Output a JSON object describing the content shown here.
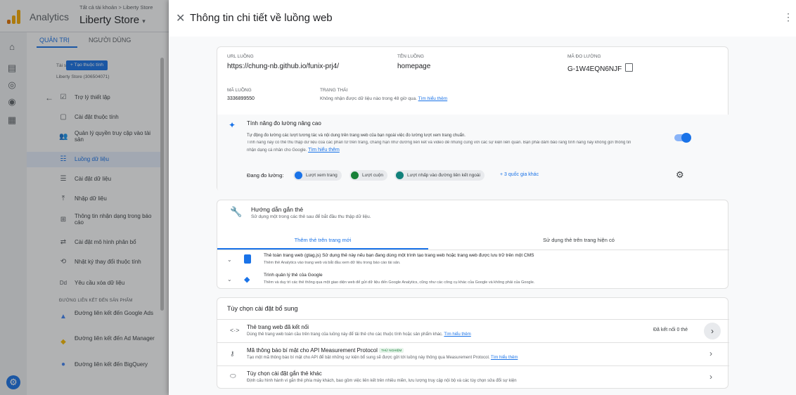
{
  "app": {
    "name": "Analytics",
    "breadcrumb": "Tất cả tài khoản > Liberty Store",
    "property": "Liberty Store",
    "colors": {
      "accent": "#1a73e8",
      "logo_orange": "#f9ab00",
      "logo_dark": "#e37400"
    }
  },
  "left_panel": {
    "tabs": [
      {
        "label": "QUẢN TRỊ",
        "active": true
      },
      {
        "label": "NGƯỜI DÙNG",
        "active": false
      }
    ],
    "asset_label": "Tài sản",
    "create_property_label": "+ Tạo thuộc tính",
    "property_id": "Liberty Store (306504071)",
    "items": [
      {
        "label": "Trợ lý thiết lập",
        "icon": "checklist-icon"
      },
      {
        "label": "Cài đặt thuộc tính",
        "icon": "property-icon"
      },
      {
        "label": "Quản lý quyền truy cập vào tài sản",
        "icon": "people-icon"
      },
      {
        "label": "Luồng dữ liệu",
        "icon": "data-stream-icon",
        "selected": true
      },
      {
        "label": "Cài đặt dữ liệu",
        "icon": "database-icon"
      },
      {
        "label": "Nhập dữ liệu",
        "icon": "upload-icon"
      },
      {
        "label": "Thông tin nhận dạng trong báo cáo",
        "icon": "identity-icon"
      },
      {
        "label": "Cài đặt mô hình phân bổ",
        "icon": "attribution-icon"
      },
      {
        "label": "Nhật ký thay đổi thuộc tính",
        "icon": "history-icon"
      },
      {
        "label": "Yêu cầu xóa dữ liệu",
        "icon": "delete-data-icon"
      }
    ],
    "section_label": "ĐƯỜNG LIÊN KẾT ĐẾN SẢN PHẨM",
    "links": [
      {
        "label": "Đường liên kết đến Google Ads",
        "icon": "google-ads-icon"
      },
      {
        "label": "Đường liên kết đến Ad Manager",
        "icon": "ad-manager-icon"
      },
      {
        "label": "Đường liên kết đến BigQuery",
        "icon": "bigquery-icon"
      }
    ]
  },
  "drawer": {
    "title": "Thông tin chi tiết về luồng web",
    "stream": {
      "url_label": "URL LUỒNG",
      "url": "https://chung-nb.github.io/funix-prj4/",
      "name_label": "TÊN LUỒNG",
      "name": "homepage",
      "measurement_id_label": "MÃ ĐO LƯỜNG",
      "measurement_id": "G-1W4EQN6NJF",
      "stream_id_label": "MÃ LUỒNG",
      "stream_id": "3336899550",
      "status_label": "TRẠNG THÁI",
      "status_text": "Không nhận được dữ liệu nào trong 48 giờ qua.",
      "status_link": "Tìm hiểu thêm"
    },
    "enhanced": {
      "title": "Tính năng đo lường nâng cao",
      "desc1": "Tự động đo lường các lượt tương tác và nội dung trên trang web của bạn ngoài việc đo lường lượt xem trang chuẩn.",
      "desc2": "Tính năng này có thể thu thập dữ liệu của các phần tử trên trang, chẳng hạn như đường liên kết và video để nhúng cùng với các sự kiện liên quan. Bạn phải đảm bảo rằng tính năng này không gửi thông tin",
      "desc3": "nhận dạng cá nhân cho Google.",
      "desc_link": "Tìm hiểu thêm",
      "measuring_label": "Đang đo lường:",
      "chips": [
        {
          "label": "Lượt xem trang",
          "icon": "eye-icon",
          "color": "#1a73e8"
        },
        {
          "label": "Lượt cuộn",
          "icon": "scroll-icon",
          "color": "#188038"
        },
        {
          "label": "Lượt nhấp vào đường liên kết ngoài",
          "icon": "click-icon",
          "color": "#12817b"
        }
      ],
      "more": "+ 3 quốc gia khác",
      "toggle_on": true
    },
    "tagging": {
      "title": "Hướng dẫn gắn thẻ",
      "subtitle": "Sử dụng một trong các thẻ sau để bắt đầu thu thập dữ liệu.",
      "tabs": [
        {
          "label": "Thêm thẻ trên trang mới",
          "active": true
        },
        {
          "label": "Sử dụng thẻ trên trang hiện có",
          "active": false
        }
      ],
      "options": [
        {
          "title": "Thẻ toàn trang web (gtag.js) Sử dụng thẻ này nếu bạn đang dùng một trình tạo trang web hoặc trang web được lưu trữ trên một CMS",
          "desc": "Thêm thẻ Analytics vào trang web và bắt đầu xem dữ liệu trong báo cáo tài sản.",
          "icon": "gtag-icon"
        },
        {
          "title": "Trình quản lý thẻ của Google",
          "desc": "Thêm và duy trì các thẻ thông qua một giao diện web để gửi dữ liệu đến Google Analytics, cũng như các công cụ khác của Google và không phải của Google.",
          "icon": "tag-manager-icon"
        }
      ]
    },
    "additional": {
      "title": "Tùy chọn cài đặt bổ sung",
      "rows": [
        {
          "title": "Thẻ trang web đã kết nối",
          "desc": "Dùng thẻ trang web toàn cầu trên trang của luồng này để tải thẻ cho các thuộc tính hoặc sản phẩm khác.",
          "link": "Tìm hiểu thêm",
          "status": "Đã kết nối 0 thẻ",
          "icon": "code-icon"
        },
        {
          "title": "Mã thông báo bí mật cho API Measurement Protocol",
          "badge": "THỬ NGHIỆM",
          "desc": "Tạo một mã thông báo bí mật cho API để bật những sự kiện bổ sung sẽ được gửi tới luồng này thông qua Measurement Protocol.",
          "link": "Tìm hiểu thêm",
          "icon": "key-icon"
        },
        {
          "title": "Tùy chọn cài đặt gắn thẻ khác",
          "desc": "Định cấu hình hành vi gắn thẻ phía máy khách, bao gồm việc liên kết trên nhiều miền, lưu lượng truy cập nội bộ và các tùy chọn sửa đổi sự kiện",
          "icon": "tag-icon"
        }
      ]
    }
  }
}
